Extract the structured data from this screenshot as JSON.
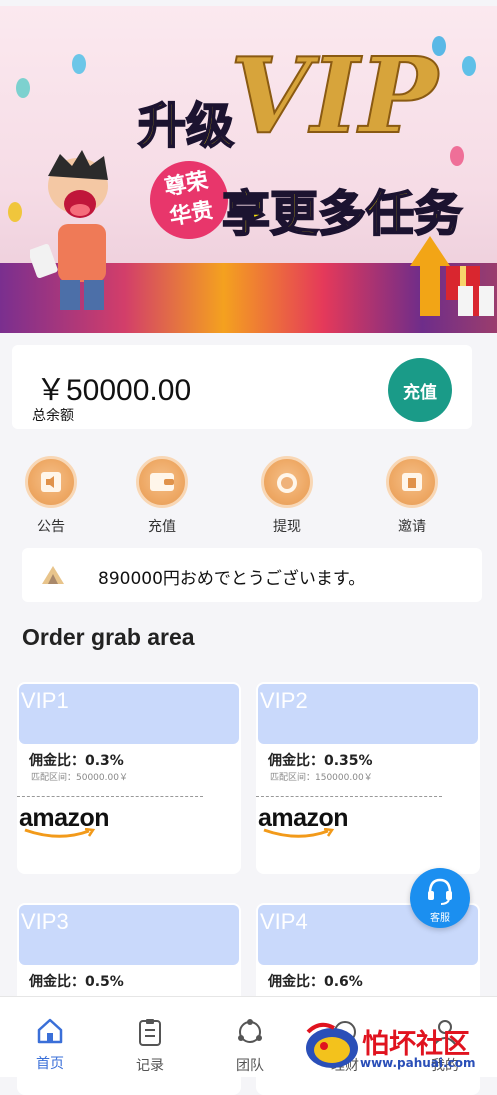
{
  "banner": {
    "title_line1": "升级",
    "title_vip": "VIP",
    "title_line2": "享更多任务",
    "badge_line1": "尊荣",
    "badge_line2": "华贵"
  },
  "balance": {
    "amount": "￥50000.00",
    "label": "总余额",
    "recharge_button": "充值"
  },
  "quick_actions": [
    {
      "label": "公告",
      "icon": "announcement-icon"
    },
    {
      "label": "充值",
      "icon": "wallet-icon"
    },
    {
      "label": "提现",
      "icon": "medal-icon"
    },
    {
      "label": "邀请",
      "icon": "invite-icon"
    }
  ],
  "notice": {
    "text": "890000円おめでとうございます。"
  },
  "section": {
    "title": "Order grab area"
  },
  "vip_levels": [
    {
      "name": "VIP1",
      "rate": "佣金比：0.3%",
      "range": "匹配区间：50000.00￥",
      "brand": "amazon"
    },
    {
      "name": "VIP2",
      "rate": "佣金比：0.35%",
      "range": "匹配区间：150000.00￥",
      "brand": "amazon"
    },
    {
      "name": "VIP3",
      "rate": "佣金比：0.5%",
      "range": "",
      "brand": ""
    },
    {
      "name": "VIP4",
      "rate": "佣金比：0.6%",
      "range": "",
      "brand": ""
    }
  ],
  "service": {
    "label": "客服"
  },
  "tabbar": [
    {
      "label": "首页",
      "icon": "home-icon",
      "active": true
    },
    {
      "label": "记录",
      "icon": "clipboard-icon",
      "active": false
    },
    {
      "label": "团队",
      "icon": "team-icon",
      "active": false
    },
    {
      "label": "理财",
      "icon": "finance-icon",
      "active": false
    },
    {
      "label": "我的",
      "icon": "profile-icon",
      "active": false
    }
  ],
  "watermark": {
    "text": "怕坏社区",
    "url": "www.pahuai.com"
  },
  "colors": {
    "accent_green": "#1a9b88",
    "vip_header": "#c9d9fb",
    "service_blue": "#1b8ff0",
    "tab_active": "#3a6fd8"
  }
}
